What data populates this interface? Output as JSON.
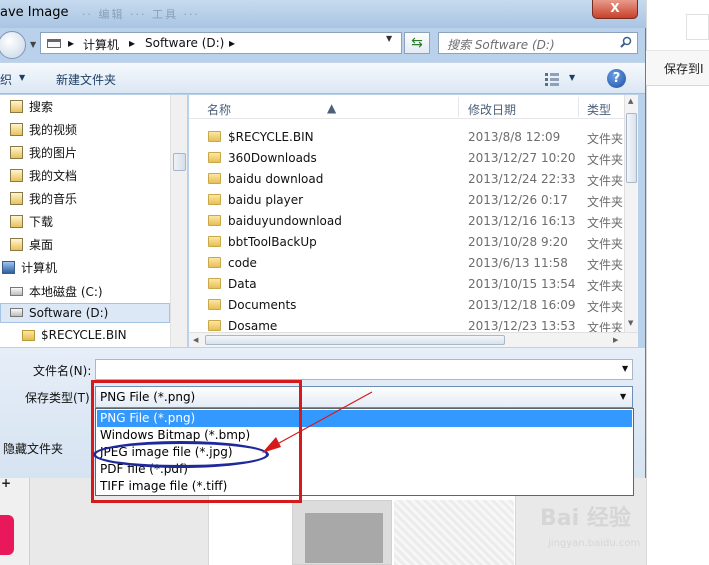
{
  "dialog": {
    "title": "ave Image",
    "close_label": "X",
    "background_menu": "·· 编辑 ··· 工具 ···"
  },
  "address_bar": {
    "segments": [
      "计算机",
      "Software (D:)"
    ],
    "separator": "▸"
  },
  "search": {
    "placeholder": "搜索 Software (D:)"
  },
  "toolbar": {
    "organize_label": "织",
    "new_folder_label": "新建文件夹",
    "help_label": "?"
  },
  "nav_pane": {
    "items": [
      {
        "label": "搜索",
        "icon": "search-folder-icon"
      },
      {
        "label": "我的视频",
        "icon": "videos-folder-icon"
      },
      {
        "label": "我的图片",
        "icon": "pictures-folder-icon"
      },
      {
        "label": "我的文档",
        "icon": "documents-folder-icon"
      },
      {
        "label": "我的音乐",
        "icon": "music-folder-icon"
      },
      {
        "label": "下载",
        "icon": "downloads-folder-icon"
      },
      {
        "label": "桌面",
        "icon": "desktop-folder-icon"
      },
      {
        "label": "计算机",
        "icon": "computer-icon"
      },
      {
        "label": "本地磁盘 (C:)",
        "icon": "drive-icon"
      },
      {
        "label": "Software (D:)",
        "icon": "drive-icon"
      },
      {
        "label": "$RECYCLE.BIN",
        "icon": "folder-icon"
      }
    ],
    "selected": "Software (D:)"
  },
  "file_list": {
    "columns": [
      "名称",
      "修改日期",
      "类型"
    ],
    "rows": [
      {
        "name": "$RECYCLE.BIN",
        "date": "2013/8/8 12:09",
        "type": "文件夹"
      },
      {
        "name": "360Downloads",
        "date": "2013/12/27 10:20",
        "type": "文件夹"
      },
      {
        "name": "baidu download",
        "date": "2013/12/24 22:33",
        "type": "文件夹"
      },
      {
        "name": "baidu player",
        "date": "2013/12/26 0:17",
        "type": "文件夹"
      },
      {
        "name": "baiduyundownload",
        "date": "2013/12/16 16:13",
        "type": "文件夹"
      },
      {
        "name": "bbtToolBackUp",
        "date": "2013/10/28 9:20",
        "type": "文件夹"
      },
      {
        "name": "code",
        "date": "2013/6/13 11:58",
        "type": "文件夹"
      },
      {
        "name": "Data",
        "date": "2013/10/15 13:54",
        "type": "文件夹"
      },
      {
        "name": "Documents",
        "date": "2013/12/18 16:09",
        "type": "文件夹"
      },
      {
        "name": "Dosame",
        "date": "2013/12/23 13:53",
        "type": "文件夹"
      }
    ]
  },
  "form": {
    "filename_label": "文件名(N):",
    "filename_value": "",
    "filetype_label": "保存类型(T):",
    "filetype_value": "PNG File (*.png)",
    "filetype_options": [
      "PNG File (*.png)",
      "Windows Bitmap (*.bmp)",
      "JPEG image file (*.jpg)",
      "PDF file (*.pdf)",
      "TIFF image file (*.tiff)"
    ],
    "hide_folders_label": "隐藏文件夹"
  },
  "background_app": {
    "right_label": "保存到I",
    "watermark": "Bai 经验",
    "watermark_sub": "jingyan.baidu.com"
  },
  "colors": {
    "selection": "#3399ff",
    "annotation_red": "#d41a1a",
    "annotation_blue": "#1f2a9a"
  }
}
